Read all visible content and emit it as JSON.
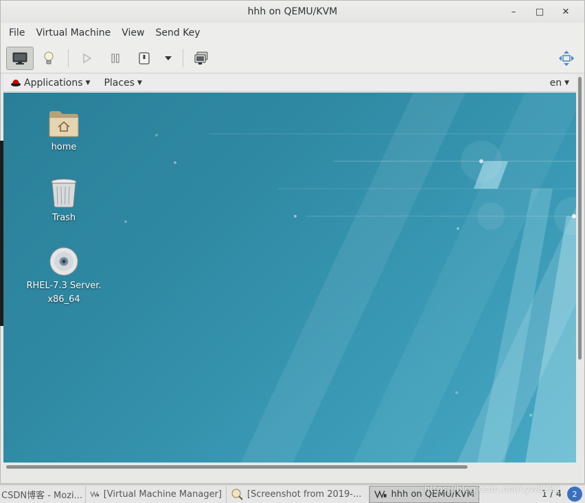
{
  "window": {
    "title": "hhh on QEMU/KVM",
    "controls": {
      "minimize": "–",
      "maximize": "□",
      "close": "✕"
    }
  },
  "menubar": {
    "items": [
      "File",
      "Virtual Machine",
      "View",
      "Send Key"
    ]
  },
  "toolbar": {
    "buttons": [
      {
        "icon": "monitor-icon",
        "active": true
      },
      {
        "icon": "lightbulb-icon",
        "active": false
      },
      {
        "icon": "play-icon",
        "active": false
      },
      {
        "icon": "pause-icon",
        "active": false
      },
      {
        "icon": "power-icon",
        "active": false
      },
      {
        "icon": "dropdown-icon",
        "active": false
      },
      {
        "icon": "screenshot-icon",
        "active": false
      },
      {
        "icon": "fullscreen-icon",
        "active": false
      }
    ]
  },
  "guest": {
    "topbar": {
      "applications": "Applications",
      "places": "Places",
      "lang": "en"
    },
    "desktop_icons": [
      {
        "label": "home",
        "icon": "home-folder-icon"
      },
      {
        "label": "Trash",
        "icon": "trash-icon"
      },
      {
        "label": "RHEL-7.3 Server.\nx86_64",
        "icon": "disc-icon"
      }
    ],
    "colors": {
      "wallpaper_dark": "#2a7f98",
      "wallpaper_light": "#48a9c4"
    }
  },
  "taskbar": {
    "tasks": [
      {
        "label": "CSDN博客 - Mozi...",
        "icon": "",
        "active": false
      },
      {
        "label": "[Virtual Machine Manager]",
        "icon": "virt-manager-icon",
        "active": false
      },
      {
        "label": "[Screenshot from 2019-...",
        "icon": "screenshot-app-icon",
        "active": false
      },
      {
        "label": "hhh on QEMU/KVM",
        "icon": "virt-manager-icon",
        "active": true
      }
    ],
    "pager": "1 / 4",
    "workspace_badge": "2",
    "watermark": "https://blog.csdn.net/cyw8282"
  }
}
